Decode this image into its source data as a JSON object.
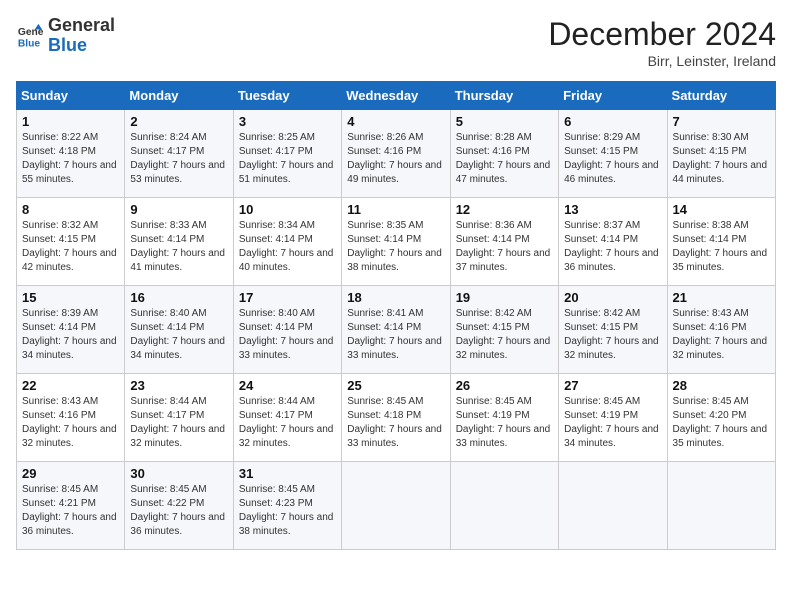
{
  "logo": {
    "line1": "General",
    "line2": "Blue"
  },
  "title": "December 2024",
  "subtitle": "Birr, Leinster, Ireland",
  "header": {
    "save_label": "December 2024",
    "location": "Birr, Leinster, Ireland"
  },
  "days_of_week": [
    "Sunday",
    "Monday",
    "Tuesday",
    "Wednesday",
    "Thursday",
    "Friday",
    "Saturday"
  ],
  "weeks": [
    [
      {
        "day": "1",
        "sunrise": "Sunrise: 8:22 AM",
        "sunset": "Sunset: 4:18 PM",
        "daylight": "Daylight: 7 hours and 55 minutes."
      },
      {
        "day": "2",
        "sunrise": "Sunrise: 8:24 AM",
        "sunset": "Sunset: 4:17 PM",
        "daylight": "Daylight: 7 hours and 53 minutes."
      },
      {
        "day": "3",
        "sunrise": "Sunrise: 8:25 AM",
        "sunset": "Sunset: 4:17 PM",
        "daylight": "Daylight: 7 hours and 51 minutes."
      },
      {
        "day": "4",
        "sunrise": "Sunrise: 8:26 AM",
        "sunset": "Sunset: 4:16 PM",
        "daylight": "Daylight: 7 hours and 49 minutes."
      },
      {
        "day": "5",
        "sunrise": "Sunrise: 8:28 AM",
        "sunset": "Sunset: 4:16 PM",
        "daylight": "Daylight: 7 hours and 47 minutes."
      },
      {
        "day": "6",
        "sunrise": "Sunrise: 8:29 AM",
        "sunset": "Sunset: 4:15 PM",
        "daylight": "Daylight: 7 hours and 46 minutes."
      },
      {
        "day": "7",
        "sunrise": "Sunrise: 8:30 AM",
        "sunset": "Sunset: 4:15 PM",
        "daylight": "Daylight: 7 hours and 44 minutes."
      }
    ],
    [
      {
        "day": "8",
        "sunrise": "Sunrise: 8:32 AM",
        "sunset": "Sunset: 4:15 PM",
        "daylight": "Daylight: 7 hours and 42 minutes."
      },
      {
        "day": "9",
        "sunrise": "Sunrise: 8:33 AM",
        "sunset": "Sunset: 4:14 PM",
        "daylight": "Daylight: 7 hours and 41 minutes."
      },
      {
        "day": "10",
        "sunrise": "Sunrise: 8:34 AM",
        "sunset": "Sunset: 4:14 PM",
        "daylight": "Daylight: 7 hours and 40 minutes."
      },
      {
        "day": "11",
        "sunrise": "Sunrise: 8:35 AM",
        "sunset": "Sunset: 4:14 PM",
        "daylight": "Daylight: 7 hours and 38 minutes."
      },
      {
        "day": "12",
        "sunrise": "Sunrise: 8:36 AM",
        "sunset": "Sunset: 4:14 PM",
        "daylight": "Daylight: 7 hours and 37 minutes."
      },
      {
        "day": "13",
        "sunrise": "Sunrise: 8:37 AM",
        "sunset": "Sunset: 4:14 PM",
        "daylight": "Daylight: 7 hours and 36 minutes."
      },
      {
        "day": "14",
        "sunrise": "Sunrise: 8:38 AM",
        "sunset": "Sunset: 4:14 PM",
        "daylight": "Daylight: 7 hours and 35 minutes."
      }
    ],
    [
      {
        "day": "15",
        "sunrise": "Sunrise: 8:39 AM",
        "sunset": "Sunset: 4:14 PM",
        "daylight": "Daylight: 7 hours and 34 minutes."
      },
      {
        "day": "16",
        "sunrise": "Sunrise: 8:40 AM",
        "sunset": "Sunset: 4:14 PM",
        "daylight": "Daylight: 7 hours and 34 minutes."
      },
      {
        "day": "17",
        "sunrise": "Sunrise: 8:40 AM",
        "sunset": "Sunset: 4:14 PM",
        "daylight": "Daylight: 7 hours and 33 minutes."
      },
      {
        "day": "18",
        "sunrise": "Sunrise: 8:41 AM",
        "sunset": "Sunset: 4:14 PM",
        "daylight": "Daylight: 7 hours and 33 minutes."
      },
      {
        "day": "19",
        "sunrise": "Sunrise: 8:42 AM",
        "sunset": "Sunset: 4:15 PM",
        "daylight": "Daylight: 7 hours and 32 minutes."
      },
      {
        "day": "20",
        "sunrise": "Sunrise: 8:42 AM",
        "sunset": "Sunset: 4:15 PM",
        "daylight": "Daylight: 7 hours and 32 minutes."
      },
      {
        "day": "21",
        "sunrise": "Sunrise: 8:43 AM",
        "sunset": "Sunset: 4:16 PM",
        "daylight": "Daylight: 7 hours and 32 minutes."
      }
    ],
    [
      {
        "day": "22",
        "sunrise": "Sunrise: 8:43 AM",
        "sunset": "Sunset: 4:16 PM",
        "daylight": "Daylight: 7 hours and 32 minutes."
      },
      {
        "day": "23",
        "sunrise": "Sunrise: 8:44 AM",
        "sunset": "Sunset: 4:17 PM",
        "daylight": "Daylight: 7 hours and 32 minutes."
      },
      {
        "day": "24",
        "sunrise": "Sunrise: 8:44 AM",
        "sunset": "Sunset: 4:17 PM",
        "daylight": "Daylight: 7 hours and 32 minutes."
      },
      {
        "day": "25",
        "sunrise": "Sunrise: 8:45 AM",
        "sunset": "Sunset: 4:18 PM",
        "daylight": "Daylight: 7 hours and 33 minutes."
      },
      {
        "day": "26",
        "sunrise": "Sunrise: 8:45 AM",
        "sunset": "Sunset: 4:19 PM",
        "daylight": "Daylight: 7 hours and 33 minutes."
      },
      {
        "day": "27",
        "sunrise": "Sunrise: 8:45 AM",
        "sunset": "Sunset: 4:19 PM",
        "daylight": "Daylight: 7 hours and 34 minutes."
      },
      {
        "day": "28",
        "sunrise": "Sunrise: 8:45 AM",
        "sunset": "Sunset: 4:20 PM",
        "daylight": "Daylight: 7 hours and 35 minutes."
      }
    ],
    [
      {
        "day": "29",
        "sunrise": "Sunrise: 8:45 AM",
        "sunset": "Sunset: 4:21 PM",
        "daylight": "Daylight: 7 hours and 36 minutes."
      },
      {
        "day": "30",
        "sunrise": "Sunrise: 8:45 AM",
        "sunset": "Sunset: 4:22 PM",
        "daylight": "Daylight: 7 hours and 36 minutes."
      },
      {
        "day": "31",
        "sunrise": "Sunrise: 8:45 AM",
        "sunset": "Sunset: 4:23 PM",
        "daylight": "Daylight: 7 hours and 38 minutes."
      },
      {
        "day": "",
        "sunrise": "",
        "sunset": "",
        "daylight": ""
      },
      {
        "day": "",
        "sunrise": "",
        "sunset": "",
        "daylight": ""
      },
      {
        "day": "",
        "sunrise": "",
        "sunset": "",
        "daylight": ""
      },
      {
        "day": "",
        "sunrise": "",
        "sunset": "",
        "daylight": ""
      }
    ]
  ]
}
